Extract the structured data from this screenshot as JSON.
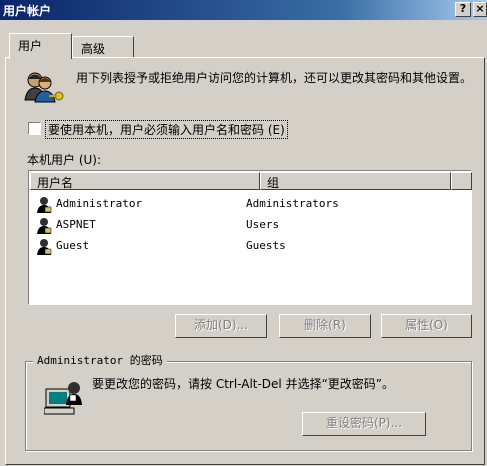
{
  "window": {
    "title": "用户帐户",
    "help_btn": "?",
    "close_btn": "×"
  },
  "tabs": [
    {
      "label": "用户",
      "active": true
    },
    {
      "label": "高级",
      "active": false
    }
  ],
  "intro": {
    "text": "用下列表授予或拒绝用户访问您的计算机，还可以更改其密码和其他设置。",
    "icon": "users-key-icon"
  },
  "require_login": {
    "checked": false,
    "label": "要使用本机，用户必须输入用户名和密码 (E)"
  },
  "local_users": {
    "label": "本机用户 (U):",
    "columns": [
      "用户名",
      "组"
    ],
    "rows": [
      {
        "name": "Administrator",
        "group": "Administrators"
      },
      {
        "name": "ASPNET",
        "group": "Users"
      },
      {
        "name": "Guest",
        "group": "Guests"
      }
    ]
  },
  "buttons": {
    "add": "添加(D)...",
    "delete": "删除(R)",
    "properties": "属性(O)"
  },
  "password_group": {
    "title": "Administrator 的密码",
    "text": "要更改您的密码，请按 Ctrl-Alt-Del 并选择“更改密码”。",
    "reset_btn": "重设密码(P)...",
    "icon": "computer-user-icon"
  },
  "colors": {
    "face": "#d4d0c8",
    "title_start": "#0a246a",
    "title_end": "#a6caf0"
  }
}
